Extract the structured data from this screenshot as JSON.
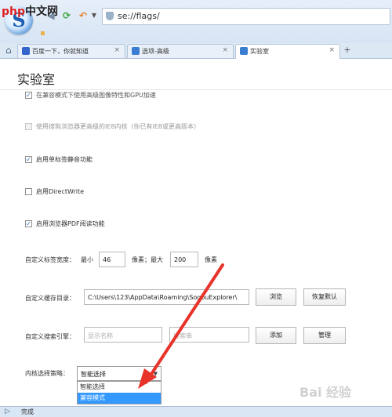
{
  "watermark": {
    "text_php": "php",
    "text_rest": "中文网"
  },
  "browser": {
    "logo_letter": "S",
    "address": "se://flags/",
    "nav_icons": [
      "back-arrow-icon",
      "refresh-icon",
      "undo-icon",
      "dropdown-icon"
    ]
  },
  "tabs": [
    {
      "label": "百度一下，你就知道",
      "color": "#3366cc"
    },
    {
      "label": "选项-高级",
      "color": "#3a7ed1"
    },
    {
      "label": "实验室",
      "color": "#3a7ed1",
      "active": true
    }
  ],
  "tab_close": "×",
  "tab_add": "+",
  "page": {
    "title": "实验室",
    "options": [
      {
        "label": "在兼容模式下使用高级图像特性和GPU加速",
        "checked": true,
        "disabled": false
      },
      {
        "label": "使用搜狗浏览器更高级的IE8内核（你已有IE8或更高版本）",
        "checked": false,
        "disabled": true
      },
      {
        "label": "启用单标签静音功能",
        "checked": true,
        "disabled": false
      },
      {
        "label": "启用DirectWrite",
        "checked": false,
        "disabled": false
      },
      {
        "label": "启用浏览器PDF阅读功能",
        "checked": true,
        "disabled": false
      }
    ],
    "tab_width": {
      "label": "自定义标签宽度：",
      "min_label": "最小",
      "min_value": "46",
      "max_label": "像素；最大",
      "max_value": "200",
      "unit": "像素"
    },
    "cache": {
      "label": "自定义缓存目录：",
      "path": "C:\\Users\\123\\AppData\\Roaming\\SogouExplorer\\",
      "browse": "浏览",
      "reset": "恢复默认"
    },
    "search_engine": {
      "label": "自定义搜索引擎：",
      "name_placeholder": "显示名称",
      "url_placeholder": "搜索串",
      "add": "添加",
      "manage": "管理"
    },
    "kernel": {
      "label": "内核选择策略：",
      "selected": "智能选择",
      "options": [
        "智能选择",
        "兼容模式"
      ],
      "highlighted": "兼容模式"
    }
  },
  "status": {
    "text": "完成"
  },
  "baidu_watermark": "Bai 经验",
  "colors": {
    "arrow": "#e8332a",
    "highlight": "#3399ff",
    "checkmark": "#2a6bbd"
  }
}
